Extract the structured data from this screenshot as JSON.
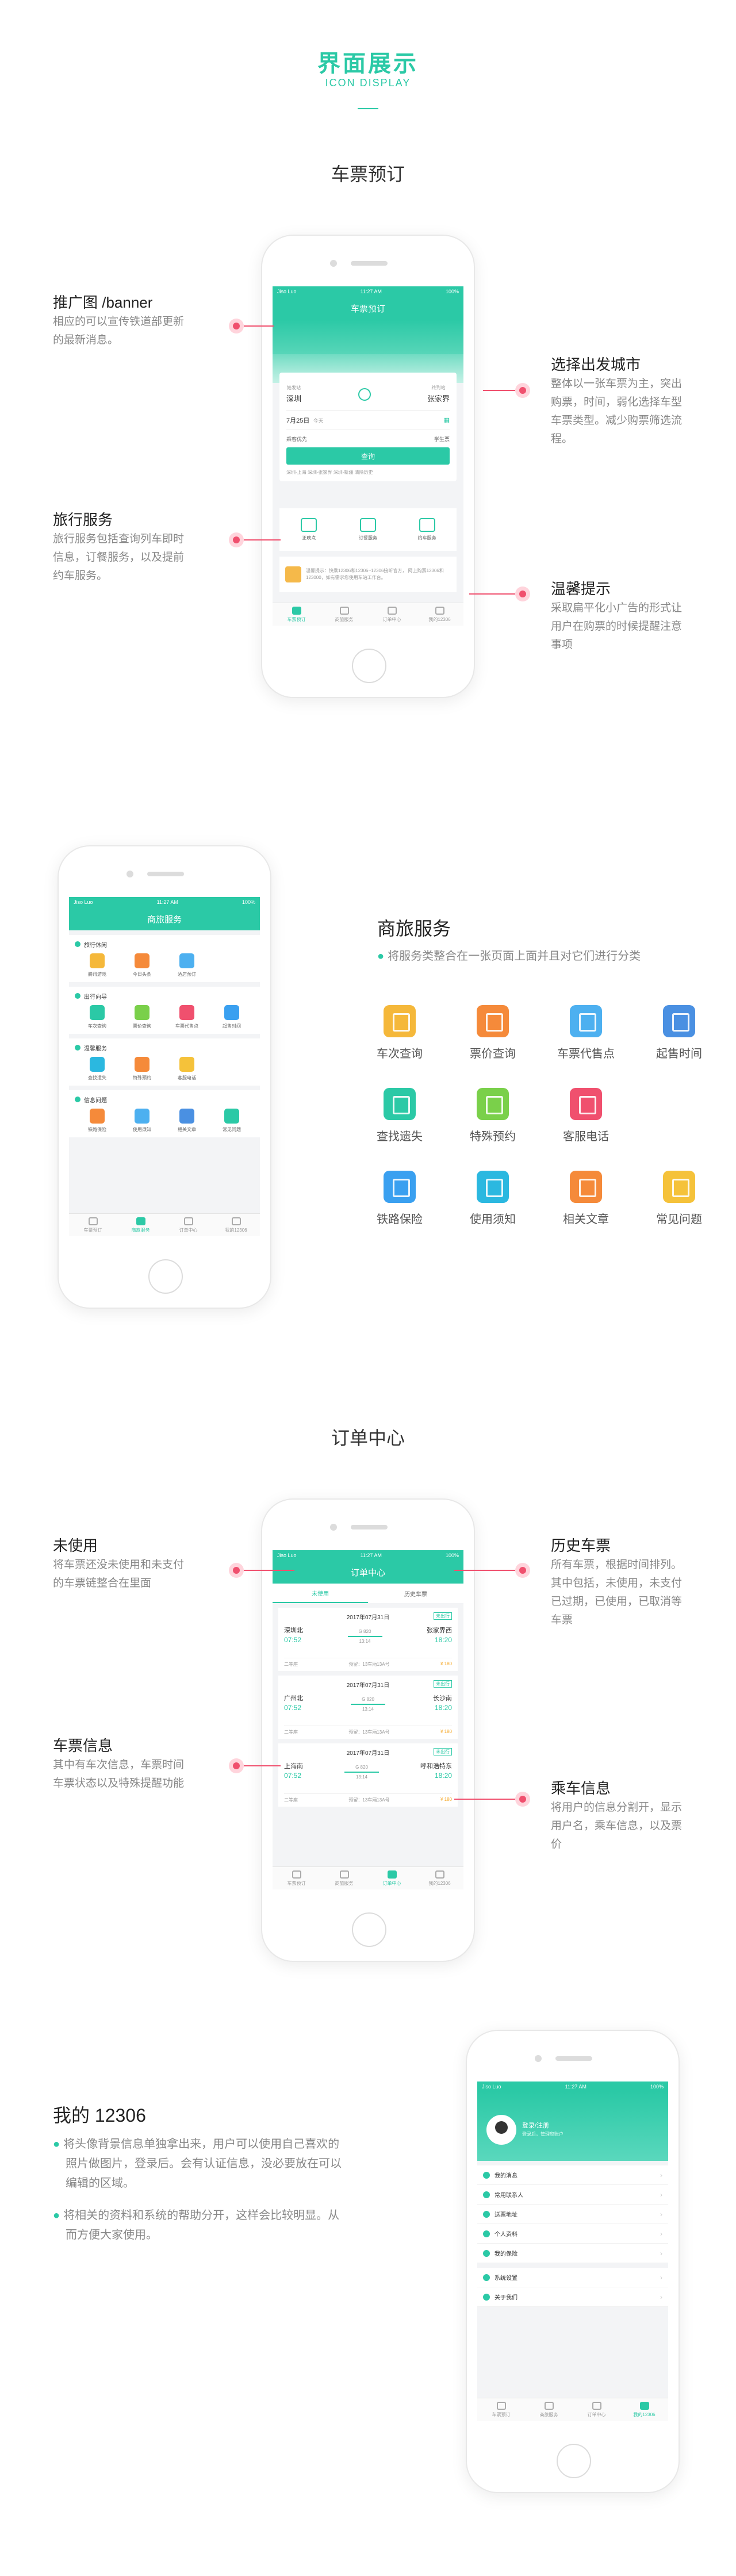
{
  "header": {
    "title": "界面展示",
    "subtitle": "ICON DISPLAY"
  },
  "phone_common": {
    "carrier": "Jiso Luo",
    "time": "11:27 AM",
    "battery": "100%"
  },
  "tabs": [
    "车票预订",
    "商旅服务",
    "订单中心",
    "我的12306"
  ],
  "section1": {
    "title": "车票预订",
    "nav_title": "车票预订",
    "from_label": "始发站",
    "from": "深圳",
    "to_label": "终到站",
    "to": "张家界",
    "date": "7月25日",
    "day": "今天",
    "opt_left": "乘客优先",
    "opt_right": "学生票",
    "query": "查询",
    "history": "深圳-上海   深圳-张家界   深圳-新疆   清除历史",
    "services": [
      "正晚点",
      "订餐服务",
      "约车服务"
    ],
    "notice": "温馨提示：快乘12306和12306~12306接听官方， 网上购票12306和123000，如有需求您使用车站工作台。",
    "callouts": {
      "banner_title": "推广图 /banner",
      "banner_desc": [
        "相应的可以宣传铁道部更新",
        "的最新消息。"
      ],
      "city_title": "选择出发城市",
      "city_desc": [
        "整体以一张车票为主，突出",
        "购票，时间，弱化选择车型",
        "车票类型。减少购票筛选流",
        "程。"
      ],
      "travel_title": "旅行服务",
      "travel_desc": [
        "旅行服务包括查询列车即时",
        "信息，订餐服务，以及提前",
        "约车服务。"
      ],
      "tip_title": "温馨提示",
      "tip_desc": [
        "采取扁平化小广告的形式让",
        "用户在购票的时候提醒注意",
        "事项"
      ]
    }
  },
  "section2": {
    "nav_title": "商旅服务",
    "title": "商旅服务",
    "desc": "将服务类整合在一张页面上面并且对它们进行分类",
    "groups": [
      {
        "name": "旅行休闲",
        "items": [
          "腾讯游戏",
          "今日头条",
          "酒店预订"
        ]
      },
      {
        "name": "出行向导",
        "items": [
          "车次查询",
          "票价查询",
          "车票代售点",
          "起售时间"
        ]
      },
      {
        "name": "温馨服务",
        "items": [
          "查找遗失",
          "特殊预约",
          "客服电话"
        ]
      },
      {
        "name": "信息问题",
        "items": [
          "铁路保险",
          "使用须知",
          "相关文章",
          "常见问题"
        ]
      }
    ],
    "grid": [
      "车次查询",
      "票价查询",
      "车票代售点",
      "起售时间",
      "查找遗失",
      "特殊预约",
      "客服电话",
      "铁路保险",
      "使用须知",
      "相关文章",
      "常见问题"
    ],
    "colors": [
      "#f5b83a",
      "#f58a3a",
      "#4db0f0",
      "#4a90e2",
      "#2bc9a6",
      "#7ad04a",
      "#f0506e",
      "#3aa0f0",
      "#2bb8e0",
      "#f58a3a",
      "#f5c23a"
    ]
  },
  "section3": {
    "title": "订单中心",
    "nav_title": "订单中心",
    "tab_unused": "未使用",
    "tab_history": "历史车票",
    "tickets": [
      {
        "date": "2017年07月31日",
        "status": "未出行",
        "from": "深圳北",
        "to": "张家界西",
        "dep": "07:52",
        "arr": "18:20",
        "train": "G 820",
        "dur": "13:14",
        "seat": "二等座",
        "extra": "预留：13车厢13A号",
        "price": "¥ 180"
      },
      {
        "date": "2017年07月31日",
        "status": "未出行",
        "from": "广州北",
        "to": "长沙南",
        "dep": "07:52",
        "arr": "18:20",
        "train": "G 820",
        "dur": "13:14",
        "seat": "二等座",
        "extra": "预留：13车厢13A号",
        "price": "¥ 180"
      },
      {
        "date": "2017年07月31日",
        "status": "未出行",
        "from": "上海南",
        "to": "呼和浩特东",
        "dep": "07:52",
        "arr": "18:20",
        "train": "G 820",
        "dur": "13:14",
        "seat": "二等座",
        "extra": "预留：13车厢13A号",
        "price": "¥ 180"
      }
    ],
    "callouts": {
      "unused_title": "未使用",
      "unused_desc": [
        "将车票还没未使用和未支付",
        "的车票链整合在里面"
      ],
      "history_title": "历史车票",
      "history_desc": [
        "所有车票，根据时间排列。",
        "其中包括，未使用，未支付",
        "已过期，已使用，已取消等",
        "车票"
      ],
      "info_title": "车票信息",
      "info_desc": [
        "其中有车次信息，车票时间",
        "车票状态以及特殊提醒功能"
      ],
      "rider_title": "乘车信息",
      "rider_desc": [
        "将用户的信息分割开，显示",
        "用户名，乘车信息，以及票",
        "价"
      ]
    }
  },
  "section4": {
    "title": "我的 12306",
    "bullets": [
      [
        "将头像背景信息单独拿出来，用户可以使用自己喜欢的",
        "照片做图片，登录后。会有认证信息，没必要放在可以",
        "编辑的区域。"
      ],
      [
        "将相关的资料和系统的帮助分开，这样会比较明显。从",
        "而方便大家使用。"
      ]
    ],
    "name": "登录/注册",
    "sub": "登录后，管理您账户",
    "menu1": [
      "我的消息",
      "常用联系人",
      "送票地址",
      "个人资料",
      "我的保险"
    ],
    "menu2": [
      "系统设置",
      "关于我们"
    ]
  }
}
